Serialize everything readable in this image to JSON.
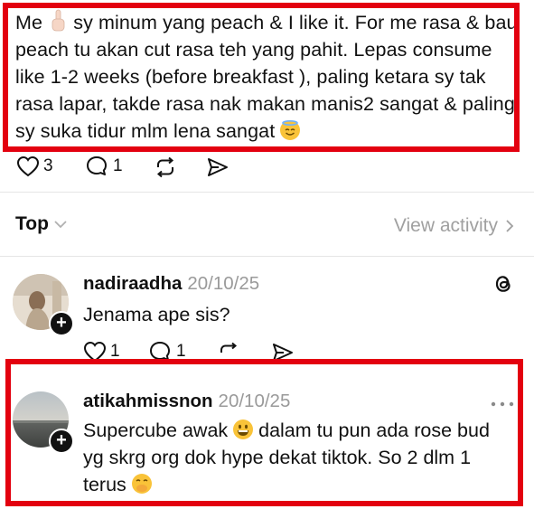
{
  "post": {
    "text_segments": [
      "Me ",
      " sy minum yang peach & I like it. For me rasa & bau peach tu akan cut rasa teh yang pahit. Lepas consume like 1-2 weeks (before breakfast ), paling ketara sy tak rasa lapar, takde rasa nak makan manis2 sangat & paling sy suka tidur mlm lena sangat "
    ],
    "likes": "3",
    "replies": "1"
  },
  "sort": {
    "label": "Top"
  },
  "activity": {
    "label": "View activity"
  },
  "comments": [
    {
      "username": "nadiraadha",
      "date": "20/10/25",
      "text": "Jenama ape sis?",
      "likes": "1",
      "replies": "1"
    },
    {
      "username": "atikahmissnon",
      "date": "20/10/25",
      "text_segments": [
        "Supercube awak ",
        " dalam tu pun ada rose bud yg skrg org dok hype dekat tiktok. So 2 dlm 1 terus "
      ]
    }
  ],
  "colors": {
    "highlight": "#e3000f",
    "muted": "#9a9a9a"
  },
  "icons": [
    "heart-icon",
    "comment-icon",
    "repost-icon",
    "share-icon",
    "threads-logo-icon",
    "more-icon",
    "chevron-down-icon",
    "chevron-right-icon",
    "follow-plus-icon"
  ]
}
